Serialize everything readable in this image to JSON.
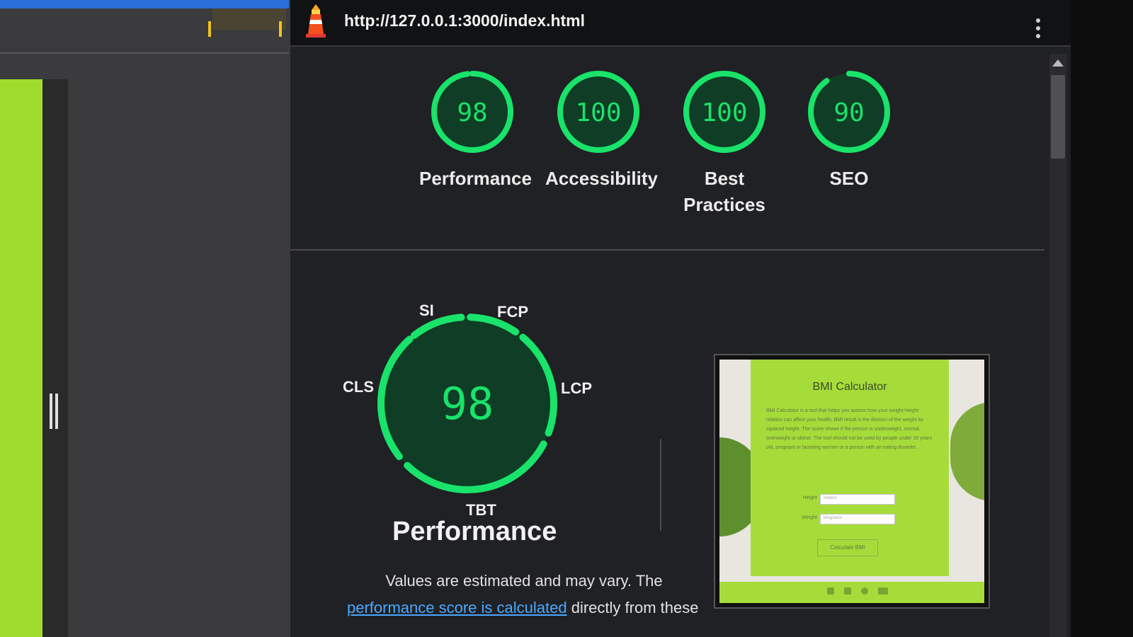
{
  "report": {
    "url": "http://127.0.0.1:3000/index.html"
  },
  "categories": [
    {
      "label": "Performance",
      "score": 98
    },
    {
      "label": "Accessibility",
      "score": 100
    },
    {
      "label": "Best Practices",
      "score": 100
    },
    {
      "label": "SEO",
      "score": 90
    }
  ],
  "performance": {
    "score": "98",
    "title": "Performance",
    "metrics": {
      "si": "SI",
      "fcp": "FCP",
      "cls": "CLS",
      "lcp": "LCP",
      "tbt": "TBT"
    },
    "note_line1": "Values are estimated and may vary. The",
    "note_link": "performance score is calculated",
    "note_line2": "directly from these"
  },
  "thumbnail": {
    "title": "BMI Calculator",
    "description": "BMI Calculator is a tool that helps you assess how your weight-height relation can affect your health. BMI result is the division of the weight by squared height. The score shows if the person is underweight, normal, overweight or obese. The tool should not be used by people under 18 years old, pregnant or lactating women or a person with an eating disorder.",
    "height_label": "Height",
    "height_placeholder": "meters",
    "weight_label": "Weight",
    "weight_placeholder": "kilograms",
    "button_label": "Calculate BMI"
  },
  "colors": {
    "pass_green": "#19e36a",
    "gauge_fill": "#0f3d26",
    "link_blue": "#4aa8ff",
    "page_green": "#9fdc2d"
  }
}
